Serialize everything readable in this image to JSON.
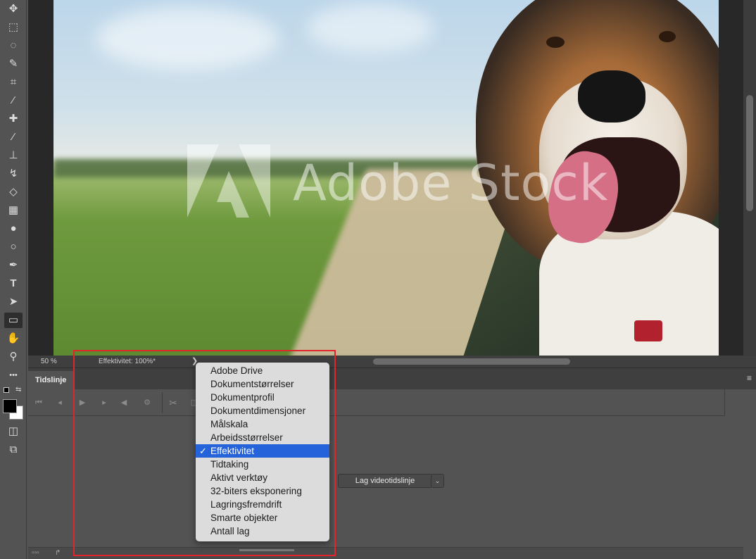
{
  "toolbar": {
    "tools": [
      "move-icon",
      "marquee-icon",
      "lasso-icon",
      "quick-select-icon",
      "crop-icon",
      "eyedropper-icon",
      "healing-icon",
      "brush-icon",
      "stamp-icon",
      "history-brush-icon",
      "eraser-icon",
      "gradient-icon",
      "blur-icon",
      "dodge-icon",
      "pen-icon",
      "type-icon",
      "path-select-icon",
      "rectangle-icon",
      "hand-icon",
      "zoom-icon",
      "more-icon"
    ],
    "type_glyph": "T",
    "more_glyph": "•••",
    "foreground_color": "#000000",
    "background_color": "#ffffff"
  },
  "canvas": {
    "watermark_text": "Adobe Stock"
  },
  "status": {
    "zoom": "50 %",
    "info": "Effektivitet: 100%*",
    "arrow": "❯"
  },
  "timeline": {
    "tab_label": "Tidslinje",
    "create_button": "Lag videotidslinje",
    "dropdown_glyph": "⌄",
    "menu_glyph": "≡"
  },
  "popup_menu": {
    "items": [
      {
        "label": "Adobe Drive",
        "checked": false
      },
      {
        "label": "Dokumentstørrelser",
        "checked": false
      },
      {
        "label": "Dokumentprofil",
        "checked": false
      },
      {
        "label": "Dokumentdimensjoner",
        "checked": false
      },
      {
        "label": "Målskala",
        "checked": false
      },
      {
        "label": "Arbeidsstørrelser",
        "checked": false
      },
      {
        "label": "Effektivitet",
        "checked": true
      },
      {
        "label": "Tidtaking",
        "checked": false
      },
      {
        "label": "Aktivt verktøy",
        "checked": false
      },
      {
        "label": "32-biters eksponering",
        "checked": false
      },
      {
        "label": "Lagringsfremdrift",
        "checked": false
      },
      {
        "label": "Smarte objekter",
        "checked": false
      },
      {
        "label": "Antall lag",
        "checked": false
      }
    ],
    "check_glyph": "✓"
  },
  "colors": {
    "highlight": "#e0262a",
    "selection": "#2463d9"
  }
}
